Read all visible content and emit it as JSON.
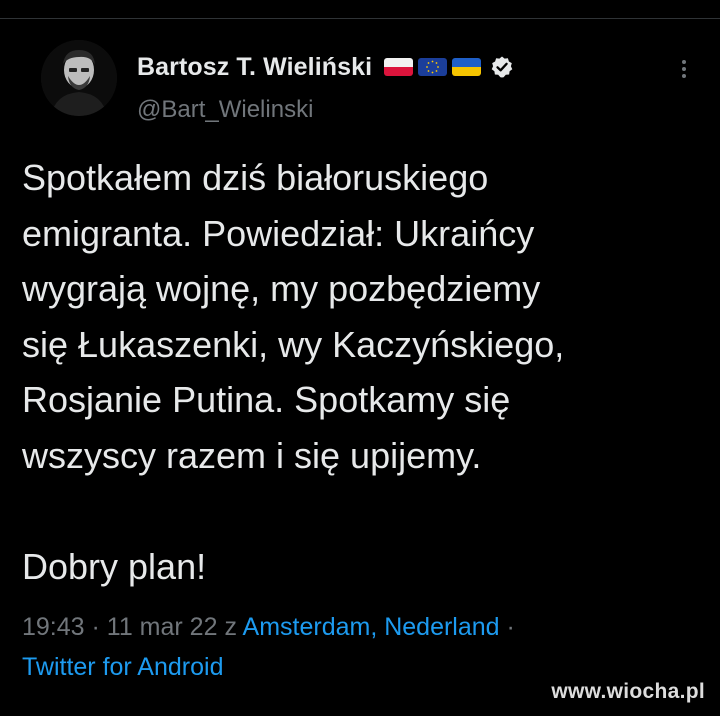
{
  "author": {
    "display_name": "Bartosz T. Wieliński",
    "handle": "@Bart_Wielinski",
    "flags": [
      "poland-flag-icon",
      "eu-flag-icon",
      "ukraine-flag-icon"
    ],
    "verified_icon": "verified-badge-icon"
  },
  "tweet": {
    "text": "Spotkałem dziś białoruskiego\nemigranta. Powiedział: Ukraińcy\nwygrają wojnę, my pozbędziemy\nsię Łukaszenki, wy Kaczyńskiego,\nRosjanie Putina. Spotkamy się\nwszyscy razem i się upijemy.\n\nDobry plan!"
  },
  "meta": {
    "time": "19:43",
    "separator": " · ",
    "date": "11 mar 22",
    "location_prefix": " z ",
    "location": "Amsterdam, Nederland",
    "trailing_separator": " ·",
    "source": "Twitter for Android"
  },
  "watermark": "www.wiocha.pl",
  "colors": {
    "background": "#000000",
    "text": "#e7e9ea",
    "secondary": "#71767b",
    "link": "#1d9bf0"
  }
}
